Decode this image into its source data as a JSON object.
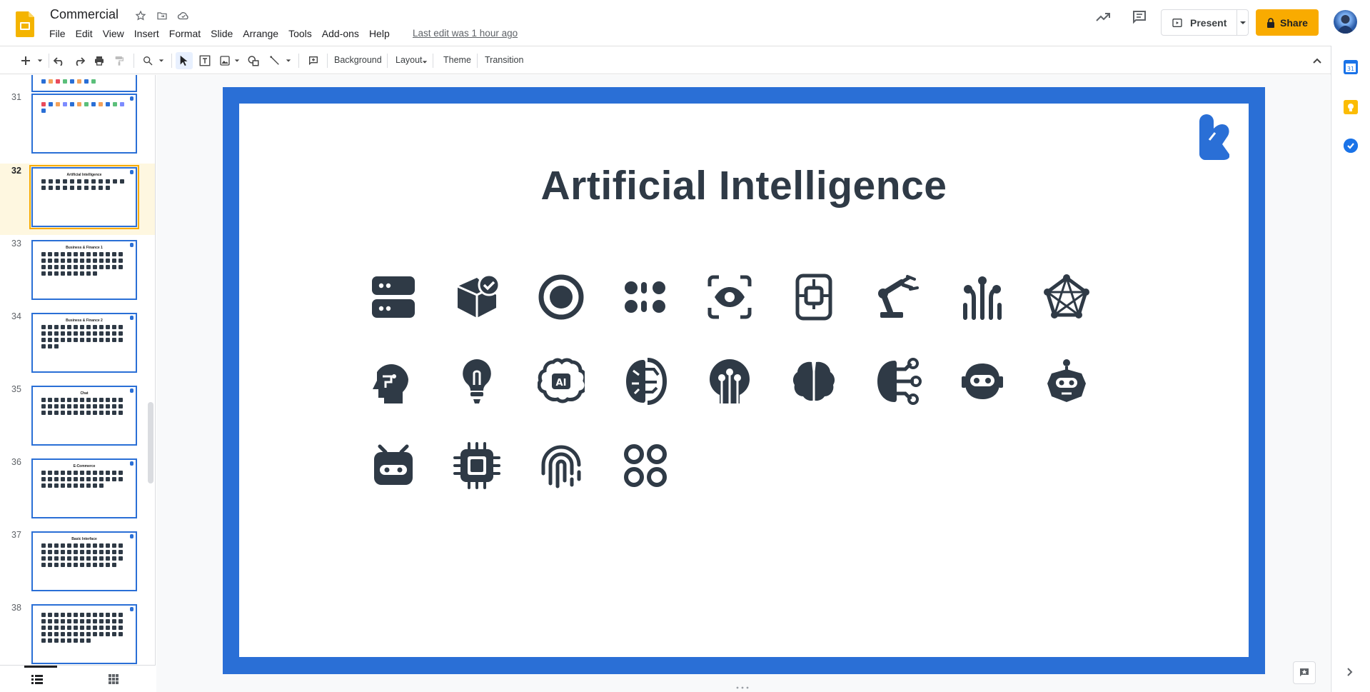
{
  "app": {
    "doc_title": "Commercial",
    "last_edit": "Last edit was 1 hour ago",
    "menu": [
      "File",
      "Edit",
      "View",
      "Insert",
      "Format",
      "Slide",
      "Arrange",
      "Tools",
      "Add-ons",
      "Help"
    ],
    "present_label": "Present",
    "share_label": "Share",
    "brand_color": "#f9ab00",
    "accent_color": "#2a6fd6"
  },
  "toolbar": {
    "background_label": "Background",
    "layout_label": "Layout",
    "theme_label": "Theme",
    "transition_label": "Transition"
  },
  "filmstrip": {
    "selected_slide": 32,
    "slides": [
      {
        "num": "31",
        "title": ""
      },
      {
        "num": "32",
        "title": "Artificial Intelligence"
      },
      {
        "num": "33",
        "title": "Business & Finance 1"
      },
      {
        "num": "34",
        "title": "Business & Finance 2"
      },
      {
        "num": "35",
        "title": "Chat"
      },
      {
        "num": "36",
        "title": "E-Commerce"
      },
      {
        "num": "37",
        "title": "Basic Interface"
      },
      {
        "num": "38",
        "title": ""
      }
    ]
  },
  "slide": {
    "title": "Artificial Intelligence",
    "icons": [
      "server-icon",
      "cube-check-icon",
      "record-icon",
      "dots-grid-icon",
      "eye-scan-icon",
      "phone-chip-icon",
      "robot-arm-icon",
      "neural-tree-icon",
      "network-star-icon",
      "head-profile-icon",
      "lightbulb-icon",
      "ai-brain-icon",
      "brain-circuit-icon",
      "head-circuit-icon",
      "brain-icon",
      "brain-nodes-icon",
      "robot-face-icon",
      "robot-head-icon",
      "robot-box-icon",
      "cpu-chip-icon",
      "fingerprint-icon",
      "four-circles-icon"
    ]
  }
}
